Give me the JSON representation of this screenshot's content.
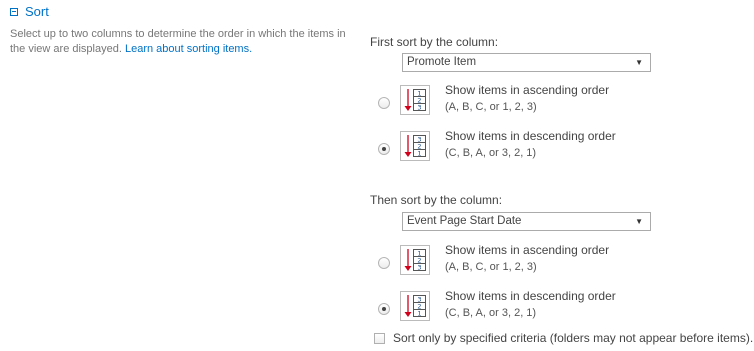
{
  "section": {
    "title": "Sort",
    "description": "Select up to two columns to determine the order in which the items in the view are displayed.",
    "learn_link": "Learn about sorting items."
  },
  "first_sort": {
    "label": "First sort by the column:",
    "selected": "Promote Item",
    "ascending": {
      "title": "Show items in ascending order",
      "detail": "(A, B, C, or 1, 2, 3)",
      "checked": false
    },
    "descending": {
      "title": "Show items in descending order",
      "detail": "(C, B, A, or 3, 2, 1)",
      "checked": true
    }
  },
  "second_sort": {
    "label": "Then sort by the column:",
    "selected": "Event Page Start Date",
    "ascending": {
      "title": "Show items in ascending order",
      "detail": "(A, B, C, or 1, 2, 3)",
      "checked": false
    },
    "descending": {
      "title": "Show items in descending order",
      "detail": "(C, B, A, or 3, 2, 1)",
      "checked": true
    }
  },
  "option_checkbox": {
    "label": "Sort only by specified criteria (folders may not appear before items).",
    "checked": false
  },
  "icons": {
    "ascending_digits": [
      "1",
      "2",
      "3"
    ],
    "descending_digits": [
      "3",
      "2",
      "1"
    ]
  },
  "colors": {
    "link": "#0072c6",
    "arrow": "#d0021b"
  }
}
